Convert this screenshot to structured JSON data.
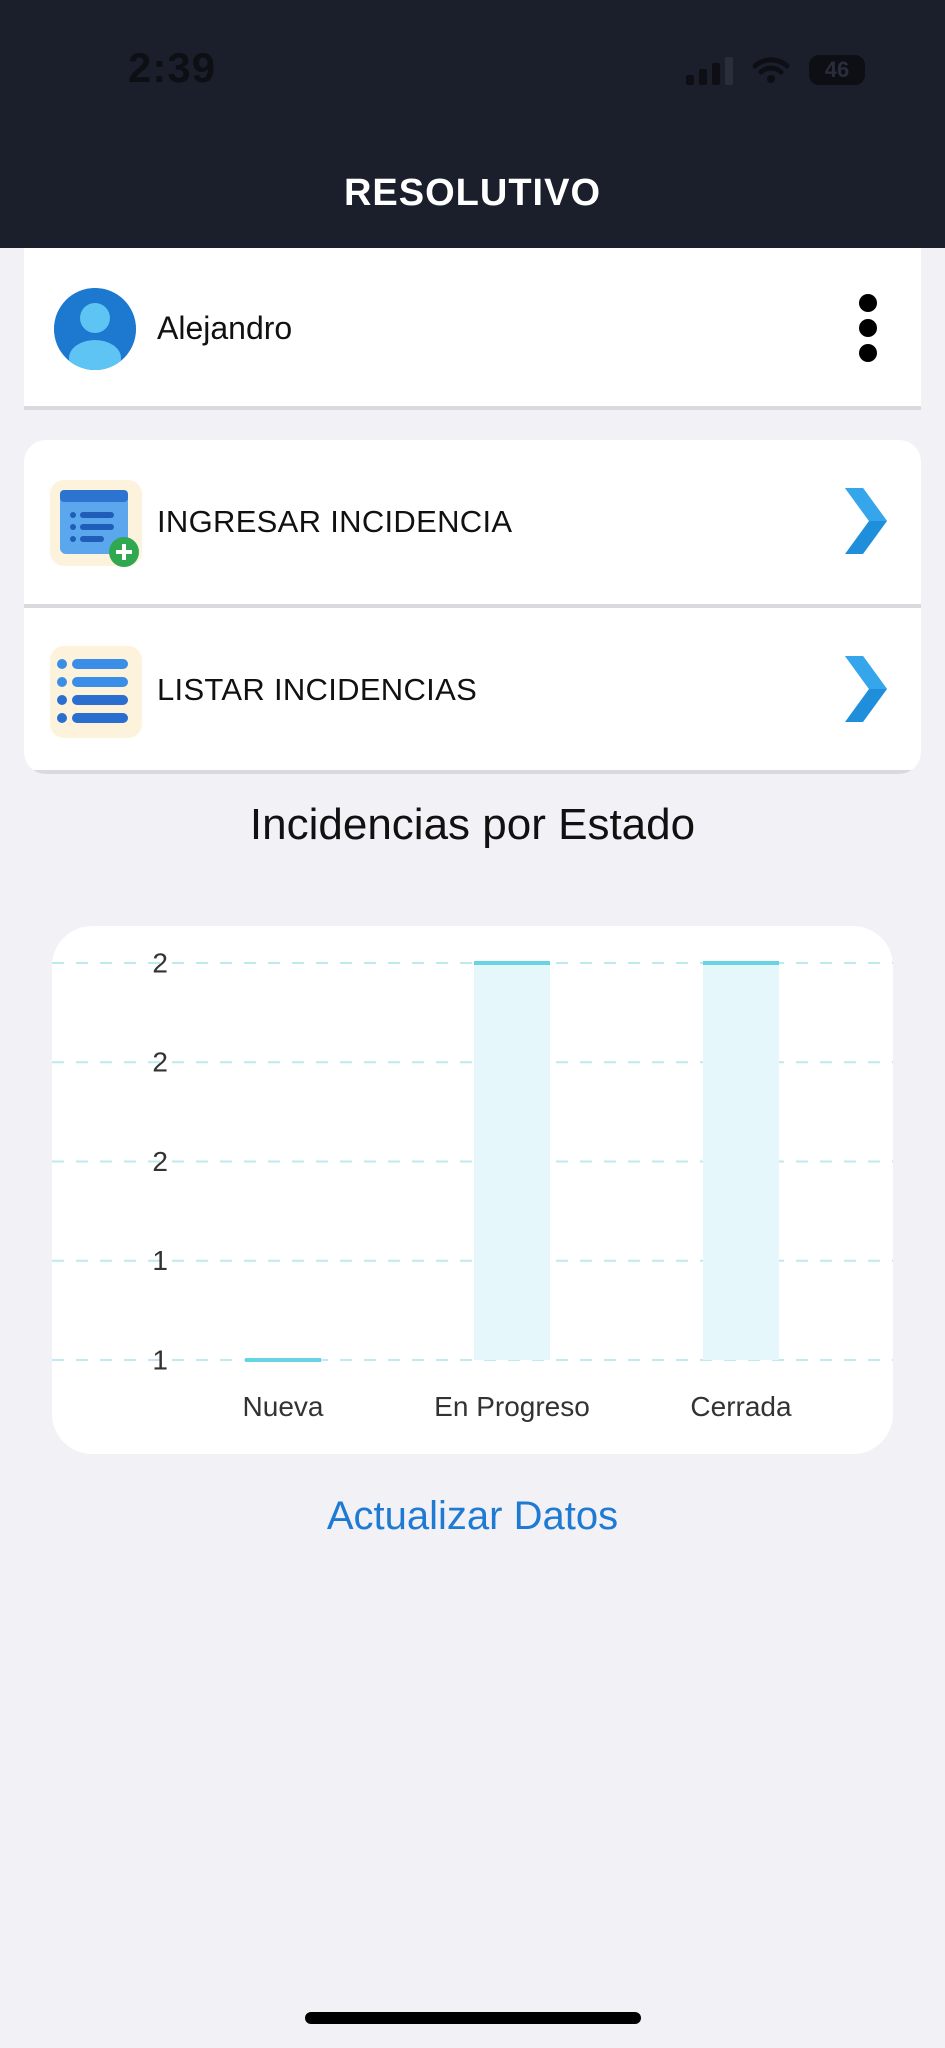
{
  "status_bar": {
    "time": "2:39",
    "battery": "46"
  },
  "header": {
    "title": "RESOLUTIVO"
  },
  "user": {
    "name": "Alejandro",
    "avatar_icon": "user-avatar-icon",
    "menu_icon": "more-vertical-icon"
  },
  "menu": {
    "items": [
      {
        "label": "INGRESAR INCIDENCIA",
        "icon": "add-list-icon",
        "chevron": "chevron-right-icon"
      },
      {
        "label": "LISTAR INCIDENCIAS",
        "icon": "list-icon",
        "chevron": "chevron-right-icon"
      }
    ]
  },
  "section": {
    "title": "Incidencias por Estado"
  },
  "chart_data": {
    "type": "bar",
    "categories": [
      "Nueva",
      "En Progreso",
      "Cerrada"
    ],
    "values": [
      1,
      2,
      2
    ],
    "y_tick_labels": [
      "2",
      "2",
      "2",
      "1",
      "1"
    ],
    "ylim": [
      1,
      2
    ],
    "grid": true,
    "bar_fill": "#e6f7fb",
    "bar_top": "#67d4e4"
  },
  "actions": {
    "refresh_label": "Actualizar Datos"
  },
  "colors": {
    "header_bg": "#1b1f2b",
    "accent": "#1f7ad3",
    "page_bg": "#f1f1f6"
  }
}
